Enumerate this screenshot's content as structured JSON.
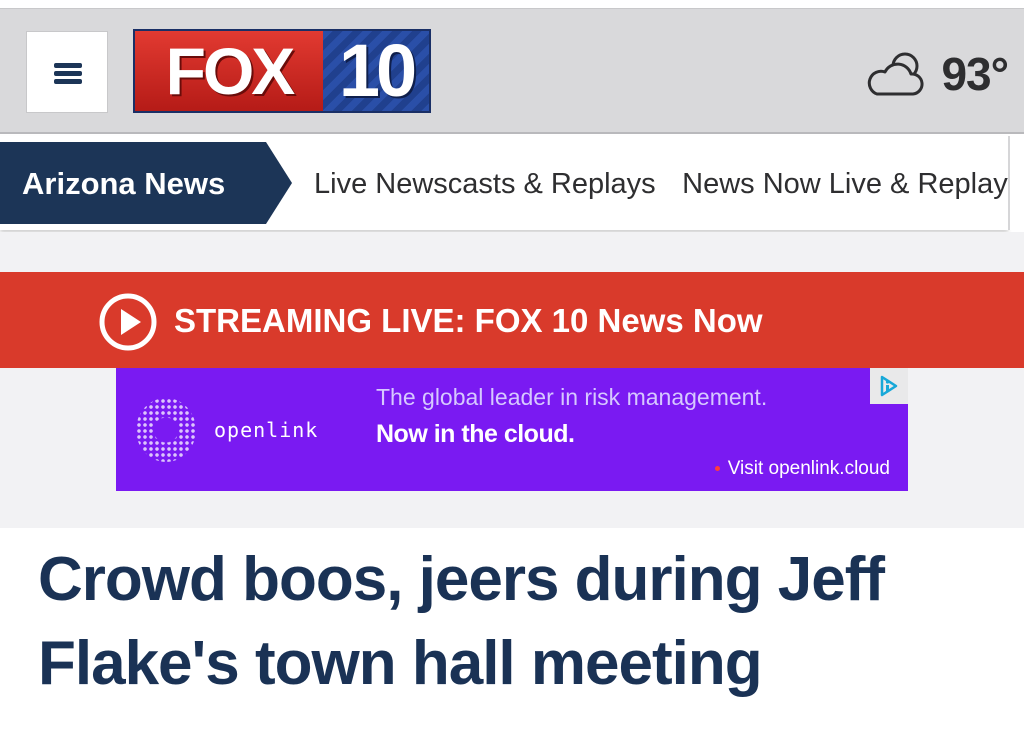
{
  "header": {
    "menu_icon": "hamburger-icon",
    "logo": {
      "brand": "FOX",
      "channel": "10"
    },
    "weather": {
      "icon": "partly-cloudy-icon",
      "temperature": "93°"
    }
  },
  "nav": {
    "active_section": "Arizona News",
    "links": [
      "Live Newscasts & Replays",
      "News Now Live & Replays"
    ]
  },
  "live_banner": {
    "icon": "play-circle-icon",
    "text": "STREAMING LIVE: FOX 10 News Now"
  },
  "ad": {
    "brand": "openlink",
    "line1": "The global leader in risk management.",
    "line2": "Now in the cloud.",
    "cta": "Visit openlink.cloud",
    "adchoices_icon": "adchoices-icon"
  },
  "article": {
    "headline": "Crowd boos, jeers during Jeff Flake's town hall meeting"
  },
  "colors": {
    "header_bg": "#d9d9db",
    "navy": "#1c3557",
    "fox_red": "#d42a24",
    "live_red": "#d93a2b",
    "ad_purple": "#7a1af2",
    "headline": "#1a3255"
  }
}
